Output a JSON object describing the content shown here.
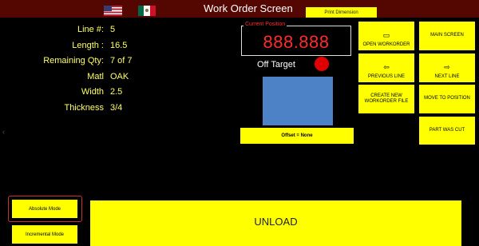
{
  "header": {
    "title": "Work Order Screen",
    "print_button": "Print Dimension",
    "flags": [
      "us-flag-icon",
      "mexico-flag-icon"
    ]
  },
  "info": {
    "line_label": "Line #:",
    "line_value": "5",
    "length_label": "Length :",
    "length_value": "16.5",
    "remaining_label": "Remaining Qty:",
    "remaining_value": "7 of 7",
    "matl_label": "Matl",
    "matl_value": "OAK",
    "width_label": "Width",
    "width_value": "2.5",
    "thickness_label": "Thickness",
    "thickness_value": "3/4"
  },
  "position": {
    "label": "Current Position",
    "value": "888.888"
  },
  "status": {
    "text": "Off Target",
    "indicator_color": "#e00000"
  },
  "offset_label": "Offset = None",
  "buttons": {
    "open_workorder": "OPEN WORKORDER",
    "main_screen": "MAIN SCREEN",
    "previous_line": "PREVIOUS LINE",
    "next_line": "NEXT LINE",
    "create_new_line1": "CREATE NEW",
    "create_new_line2": "WORKORDER FILE",
    "move_to_position": "MOVE TO POSITION",
    "part_was_cut": "PART WAS CUT"
  },
  "modes": {
    "absolute": "Absolute Mode",
    "incremental": "Incremental Mode"
  },
  "unload": "UNLOAD",
  "colors": {
    "header_bg": "#540600",
    "button_yellow": "#ffff00",
    "label_yellow": "#ffff66",
    "position_red": "#ff2a2a",
    "display_blue": "#4e82c6"
  }
}
